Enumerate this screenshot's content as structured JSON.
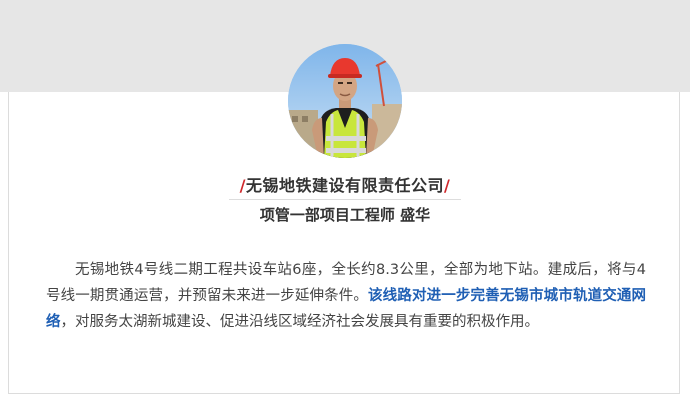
{
  "profile": {
    "company": "无锡地铁建设有限责任公司",
    "slash_left": "/",
    "slash_right": "/",
    "role": "项管一部项目工程师 盛华"
  },
  "paragraph": {
    "part1": "无锡地铁4号线二期工程共设车站6座，全长约8.3公里，全部为地下站。建成后，将与4号线一期贯通运营，并预留未来进一步延伸条件。",
    "highlight": "该线路对进一步完善无锡市城市轨道交通网络",
    "part2": "，对服务太湖新城建设、促进沿线区域经济社会发展具有重要的积极作用。"
  },
  "colors": {
    "slash": "#d0282c",
    "highlight": "#1f5fb4",
    "top_band": "#e6e6e6"
  },
  "icons": {
    "avatar": "worker-portrait-photo"
  }
}
